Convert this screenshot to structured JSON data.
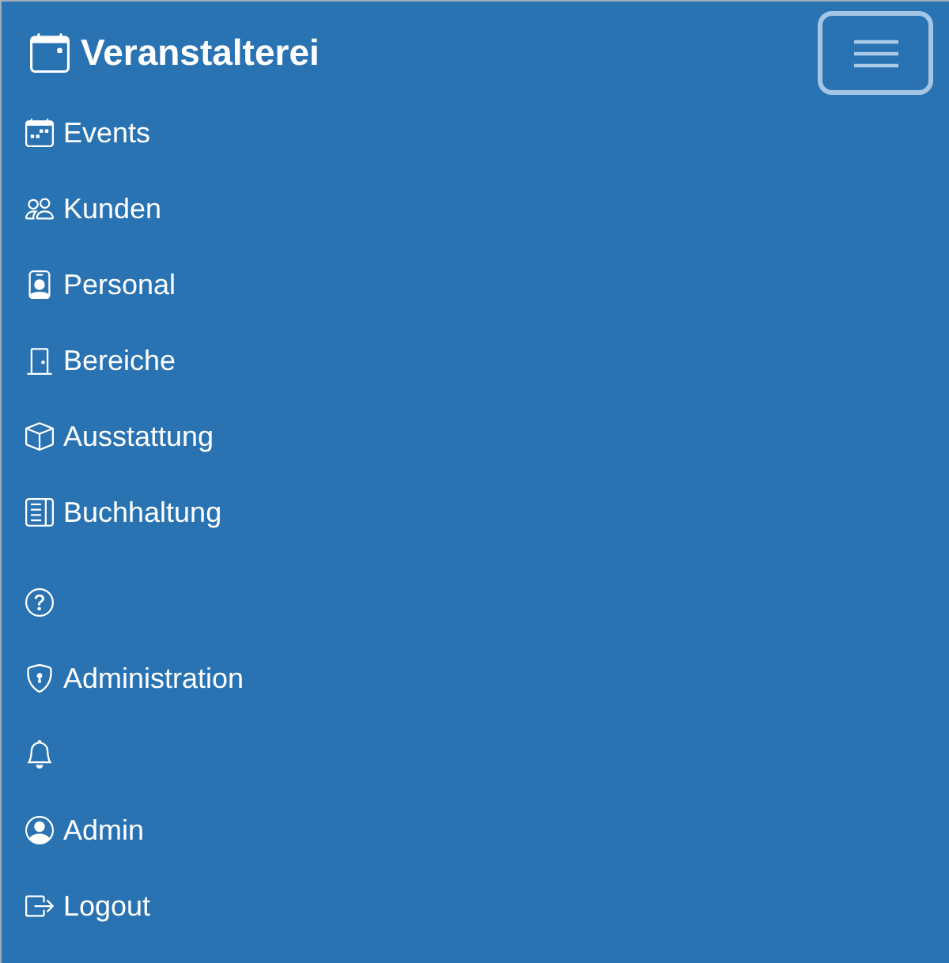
{
  "brand": {
    "title": "Veranstalterei"
  },
  "nav": {
    "items": [
      {
        "label": "Events"
      },
      {
        "label": "Kunden"
      },
      {
        "label": "Personal"
      },
      {
        "label": "Bereiche"
      },
      {
        "label": "Ausstattung"
      },
      {
        "label": "Buchhaltung"
      }
    ]
  },
  "user_nav": {
    "items": [
      {
        "kind": "icon"
      },
      {
        "kind": "link",
        "label": "Administration"
      },
      {
        "kind": "icon"
      },
      {
        "kind": "link",
        "label": "Admin"
      },
      {
        "kind": "link",
        "label": "Logout"
      }
    ]
  }
}
